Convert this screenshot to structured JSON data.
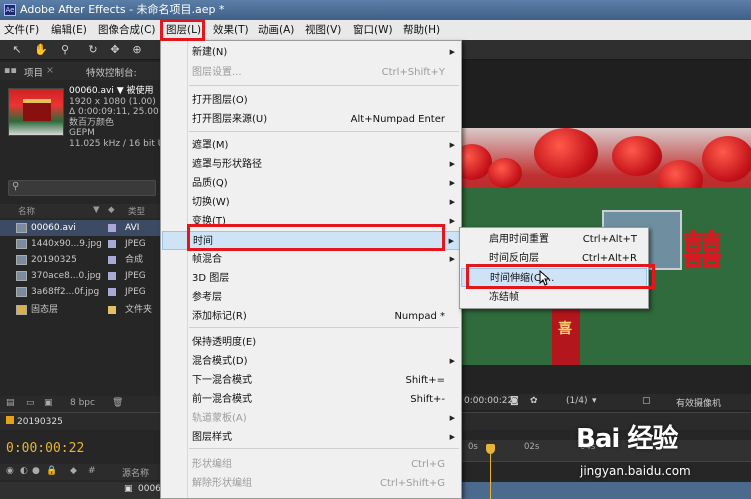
{
  "window": {
    "title": "Adobe After Effects - 未命名项目.aep *"
  },
  "menubar": {
    "items": [
      "文件(F)",
      "编辑(E)",
      "图像合成(C)",
      "图层(L)",
      "效果(T)",
      "动画(A)",
      "视图(V)",
      "窗口(W)",
      "帮助(H)"
    ],
    "active_index": 3
  },
  "panels": {
    "project_tab": "项目",
    "effects_tab": "特效控制台:"
  },
  "project": {
    "file_info": {
      "name": "00060.avi",
      "used": "▼ 被使用",
      "size": "1920 x 1080 (1.00)",
      "duration": "Δ 0:00:09:11, 25.00 fps",
      "colors": "数百万颜色",
      "codec": "GEPM",
      "audio": "11.025 kHz / 16 bit U"
    },
    "columns": {
      "name": "名称",
      "type": "类型"
    },
    "items": [
      {
        "name": "00060.avi",
        "type": "AVI",
        "label_color": "#a9a9d9",
        "selected": true
      },
      {
        "name": "1440x90...9.jpg",
        "type": "JPEG",
        "label_color": "#a9a9d9",
        "selected": false
      },
      {
        "name": "20190325",
        "type": "合成",
        "label_color": "#a9a9d9",
        "selected": false
      },
      {
        "name": "370ace8...0.jpg",
        "type": "JPEG",
        "label_color": "#a9a9d9",
        "selected": false
      },
      {
        "name": "3a68ff2...0f.jpg",
        "type": "JPEG",
        "label_color": "#a9a9d9",
        "selected": false
      },
      {
        "name": "固态层",
        "type": "文件夹",
        "label_color": "#e0c060",
        "selected": false
      }
    ],
    "bit_depth": "8 bpc"
  },
  "layer_menu": {
    "items": [
      {
        "label": "新建(N)",
        "shortcut": "",
        "submenu": true,
        "disabled": false
      },
      {
        "label": "图层设置...",
        "shortcut": "Ctrl+Shift+Y",
        "submenu": false,
        "disabled": true
      },
      {
        "label": "打开图层(O)",
        "shortcut": "",
        "submenu": false,
        "disabled": false
      },
      {
        "label": "打开图层来源(U)",
        "shortcut": "Alt+Numpad Enter",
        "submenu": false,
        "disabled": false
      },
      {
        "label": "遮罩(M)",
        "shortcut": "",
        "submenu": true,
        "disabled": false
      },
      {
        "label": "遮罩与形状路径",
        "shortcut": "",
        "submenu": true,
        "disabled": false
      },
      {
        "label": "品质(Q)",
        "shortcut": "",
        "submenu": true,
        "disabled": false
      },
      {
        "label": "切换(W)",
        "shortcut": "",
        "submenu": true,
        "disabled": false
      },
      {
        "label": "变换(T)",
        "shortcut": "",
        "submenu": true,
        "disabled": false
      },
      {
        "label": "时间",
        "shortcut": "",
        "submenu": true,
        "disabled": false
      },
      {
        "label": "帧混合",
        "shortcut": "",
        "submenu": true,
        "disabled": false
      },
      {
        "label": "3D 图层",
        "shortcut": "",
        "submenu": false,
        "disabled": false
      },
      {
        "label": "参考层",
        "shortcut": "",
        "submenu": false,
        "disabled": false
      },
      {
        "label": "添加标记(R)",
        "shortcut": "Numpad *",
        "submenu": false,
        "disabled": false
      },
      {
        "label": "保持透明度(E)",
        "shortcut": "",
        "submenu": false,
        "disabled": false
      },
      {
        "label": "混合模式(D)",
        "shortcut": "",
        "submenu": true,
        "disabled": false
      },
      {
        "label": "下一混合模式",
        "shortcut": "Shift+=",
        "submenu": false,
        "disabled": false
      },
      {
        "label": "前一混合模式",
        "shortcut": "Shift+-",
        "submenu": false,
        "disabled": false
      },
      {
        "label": "轨道蒙板(A)",
        "shortcut": "",
        "submenu": true,
        "disabled": true
      },
      {
        "label": "图层样式",
        "shortcut": "",
        "submenu": true,
        "disabled": false
      },
      {
        "label": "形状编组",
        "shortcut": "Ctrl+G",
        "submenu": false,
        "disabled": true
      },
      {
        "label": "解除形状编组",
        "shortcut": "Ctrl+Shift+G",
        "submenu": false,
        "disabled": true
      }
    ]
  },
  "time_submenu": {
    "items": [
      {
        "label": "启用时间重置",
        "shortcut": "Ctrl+Alt+T"
      },
      {
        "label": "时间反向层",
        "shortcut": "Ctrl+Alt+R"
      },
      {
        "label": "时间伸缩(C)...",
        "shortcut": ""
      },
      {
        "label": "冻结帧",
        "shortcut": ""
      }
    ]
  },
  "viewer": {
    "timecode": "0:00:00:22",
    "resolution": "(1/4)",
    "camera": "有效摄像机"
  },
  "timeline": {
    "comp_name": "20190325",
    "timecode": "0:00:00:22",
    "source_name_col": "源名称",
    "layer_name": "00060.avi",
    "ruler_marks": [
      "0s",
      "02s",
      "04s"
    ]
  },
  "watermark": {
    "brand": "Bai 经验",
    "url": "jingyan.baidu.com"
  }
}
